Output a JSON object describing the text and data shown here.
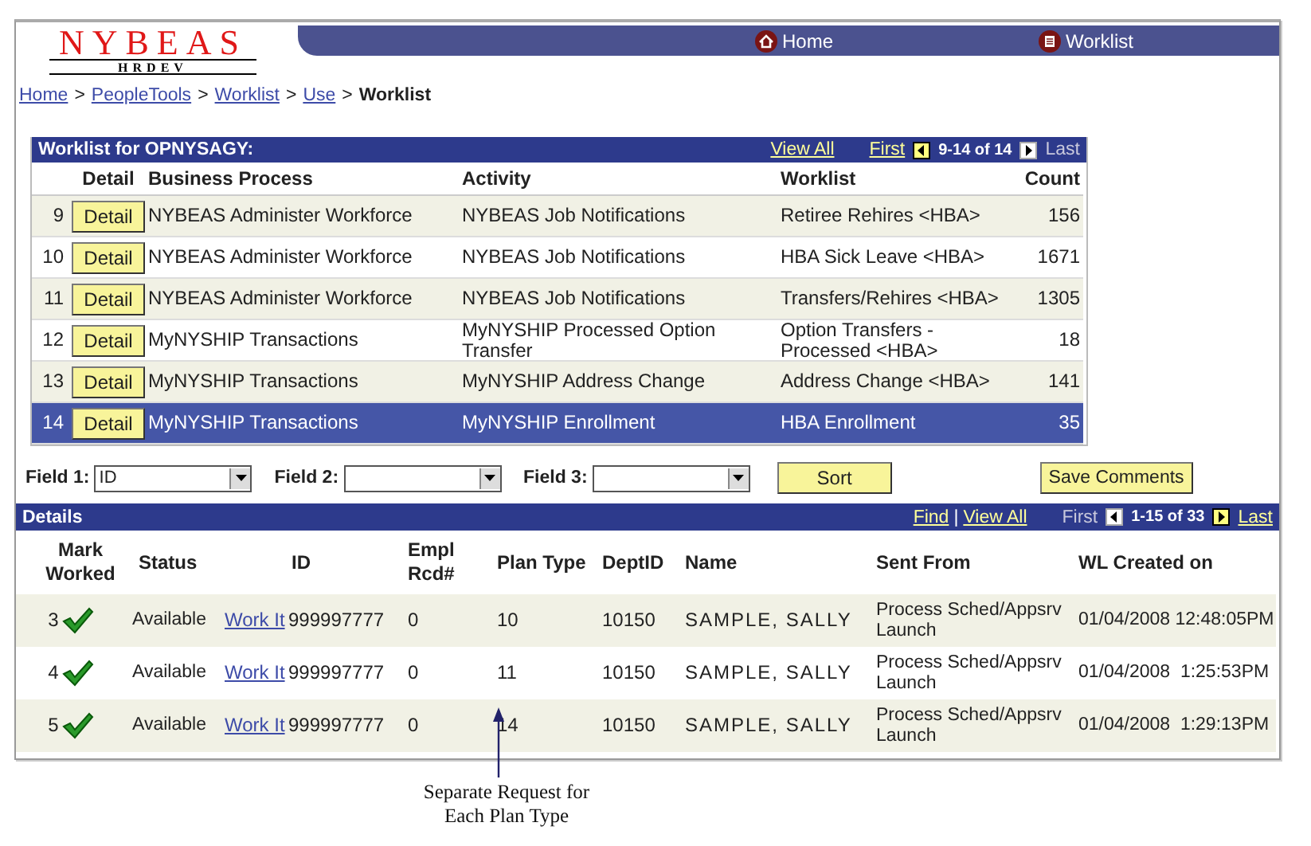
{
  "logo": {
    "title": "NYBEAS",
    "subtitle": "HRDEV"
  },
  "nav": [
    {
      "label": "Home",
      "kind": "home"
    },
    {
      "label": "Worklist",
      "kind": "worklist"
    }
  ],
  "breadcrumb_separator": ">",
  "breadcrumb": [
    {
      "label": "Home",
      "link": true
    },
    {
      "label": "PeopleTools",
      "link": true
    },
    {
      "label": "Worklist",
      "link": true
    },
    {
      "label": "Use",
      "link": true
    },
    {
      "label": "Worklist",
      "link": false
    }
  ],
  "worklist": {
    "title": "Worklist for OPNYSAGY:",
    "view_all": "View All",
    "pager": {
      "first": "First",
      "first_enabled": true,
      "previous_enabled": true,
      "range": "9-14 of 14",
      "next_enabled": false,
      "last": "Last",
      "last_enabled": false
    },
    "columns": [
      "Detail",
      "Business Process",
      "Activity",
      "Worklist",
      "Count"
    ],
    "rows": [
      {
        "number": "9",
        "button": "Detail",
        "business_process": "NYBEAS Administer Workforce",
        "activity": "NYBEAS Job Notifications",
        "worklist": "Retiree Rehires <HBA>",
        "count": "156",
        "selected": false
      },
      {
        "number": "10",
        "button": "Detail",
        "business_process": "NYBEAS Administer Workforce",
        "activity": "NYBEAS Job Notifications",
        "worklist": "HBA Sick Leave <HBA>",
        "count": "1671",
        "selected": false
      },
      {
        "number": "11",
        "button": "Detail",
        "business_process": "NYBEAS Administer Workforce",
        "activity": "NYBEAS Job Notifications",
        "worklist": "Transfers/Rehires <HBA>",
        "count": "1305",
        "selected": false
      },
      {
        "number": "12",
        "button": "Detail",
        "business_process": "MyNYSHIP Transactions",
        "activity": "MyNYSHIP Processed Option Transfer",
        "worklist": "Option Transfers - Processed <HBA>",
        "count": "18",
        "selected": false
      },
      {
        "number": "13",
        "button": "Detail",
        "business_process": "MyNYSHIP Transactions",
        "activity": "MyNYSHIP Address Change",
        "worklist": "Address Change <HBA>",
        "count": "141",
        "selected": false
      },
      {
        "number": "14",
        "button": "Detail",
        "business_process": "MyNYSHIP Transactions",
        "activity": "MyNYSHIP Enrollment",
        "worklist": "HBA Enrollment",
        "count": "35",
        "selected": true
      }
    ]
  },
  "sort": {
    "fields": [
      {
        "label": "Field 1:",
        "value": "ID"
      },
      {
        "label": "Field 2:"
      },
      {
        "label": "Field 3:"
      }
    ],
    "sort_button": "Sort",
    "save_button": "Save Comments"
  },
  "details": {
    "title": "Details",
    "find": "Find",
    "separator": "|",
    "view_all": "View All",
    "pager": {
      "first": "First",
      "first_enabled": false,
      "previous_enabled": false,
      "range": "1-15 of 33",
      "next_enabled": true,
      "last": "Last",
      "last_enabled": true
    },
    "columns": [
      "Mark Worked",
      "Status",
      "ID",
      "Empl Rcd#",
      "Plan Type",
      "DeptID",
      "Name",
      "Sent From",
      "WL Created on"
    ],
    "rows": [
      {
        "number": "3",
        "worked": true,
        "status": "Available",
        "link": "Work It",
        "id": "999997777",
        "empl_rcd": "0",
        "plan_type": "10",
        "dept_id": "10150",
        "name": "SAMPLE, SALLY",
        "sent_from": "Process Sched/Appsrv Launch",
        "created": "01/04/2008 12:48:05PM"
      },
      {
        "number": "4",
        "worked": true,
        "status": "Available",
        "link": "Work It",
        "id": "999997777",
        "empl_rcd": "0",
        "plan_type": "11",
        "dept_id": "10150",
        "name": "SAMPLE, SALLY",
        "sent_from": "Process Sched/Appsrv Launch",
        "created": "01/04/2008  1:25:53PM"
      },
      {
        "number": "5",
        "worked": true,
        "status": "Available",
        "link": "Work It",
        "id": "999997777",
        "empl_rcd": "0",
        "plan_type": "14",
        "dept_id": "10150",
        "name": "SAMPLE, SALLY",
        "sent_from": "Process Sched/Appsrv Launch",
        "created": "01/04/2008  1:29:13PM"
      }
    ]
  },
  "annotation": {
    "text": "Separate Request for Each Plan Type"
  }
}
